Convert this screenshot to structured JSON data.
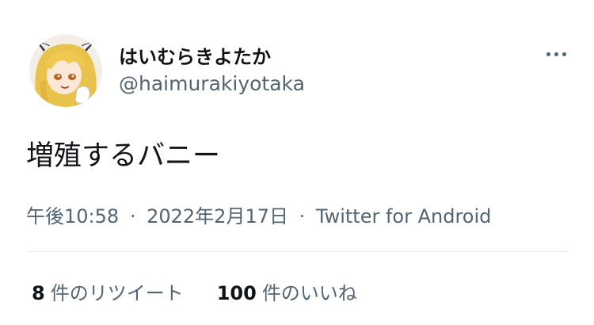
{
  "tweet": {
    "author": {
      "display_name": "はいむらきよたか",
      "handle": "@haimurakiyotaka"
    },
    "text": "増殖するバニー",
    "meta": {
      "time": "午後10:58",
      "date": "2022年2月17日",
      "client": "Twitter for Android",
      "separator": "·"
    },
    "stats": {
      "retweet_count": "8",
      "retweet_label": "件のリツイート",
      "like_count": "100",
      "like_label": "件のいいね"
    },
    "icons": {
      "more": "more-horizontal-icon"
    },
    "colors": {
      "text_primary": "#0f1419",
      "text_secondary": "#536471",
      "divider": "#e6ecf0"
    }
  }
}
